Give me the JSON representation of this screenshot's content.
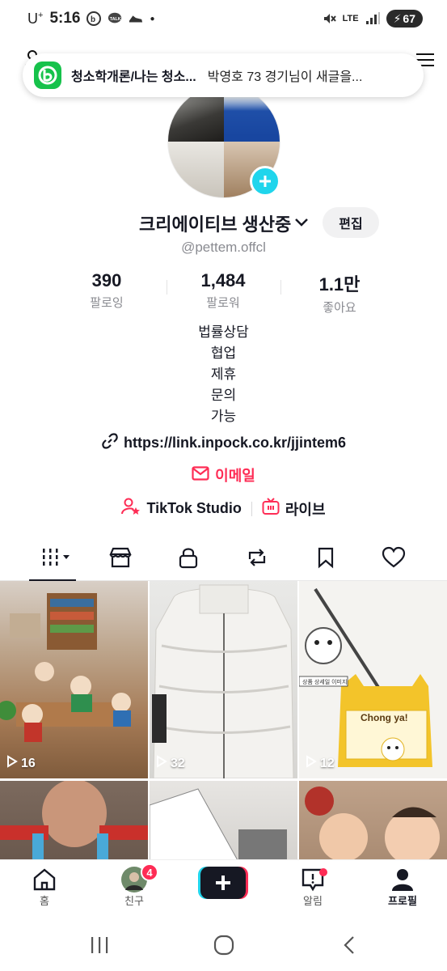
{
  "statusbar": {
    "carrier": "U",
    "carrier_sup": "+",
    "time": "5:16",
    "talk_label": "TALK",
    "network": "LTE",
    "battery": "67"
  },
  "notification": {
    "app_icon": "band-app-icon",
    "title": "청소학개론/나는 청소...",
    "body": "박영호  73 경기님이 새글을..."
  },
  "profile": {
    "display_name": "크리에이티브 생산중",
    "handle": "@pettem.offcl",
    "edit_label": "편집",
    "stats": [
      {
        "value": "390",
        "label": "팔로잉"
      },
      {
        "value": "1,484",
        "label": "팔로워"
      },
      {
        "value": "1.1만",
        "label": "좋아요"
      }
    ],
    "bio_lines": [
      "법률상담",
      "협업",
      "제휴",
      "문의",
      "가능"
    ],
    "link": "https://link.inpock.co.kr/jjintem6",
    "email_label": "이메일",
    "tools": [
      {
        "label": "TikTok Studio",
        "icon": "studio-icon"
      },
      {
        "label": "라이브",
        "icon": "live-tv-icon"
      }
    ]
  },
  "tabs": [
    {
      "icon": "videos-grid-icon",
      "active": true
    },
    {
      "icon": "shop-icon"
    },
    {
      "icon": "lock-icon"
    },
    {
      "icon": "repost-icon"
    },
    {
      "icon": "bookmark-icon"
    },
    {
      "icon": "heart-icon"
    }
  ],
  "videos": [
    {
      "views": "16",
      "theme": "classroom illustration"
    },
    {
      "views": "32",
      "theme": "white puffer jacket"
    },
    {
      "views": "12",
      "theme": "Chong ya! bag",
      "bag_text": "Chong ya!",
      "sticker_text": "상품 상세일 이미지"
    },
    {
      "theme": "man with handlebars"
    },
    {
      "theme": "tablet drawing"
    },
    {
      "theme": "kids smiling"
    }
  ],
  "bottomnav": [
    {
      "label": "홈",
      "icon": "home-icon"
    },
    {
      "label": "친구",
      "icon": "friends-avatar-icon",
      "badge": "4"
    },
    {
      "label": "",
      "icon": "create-plus-icon"
    },
    {
      "label": "알림",
      "icon": "inbox-icon",
      "dot": true
    },
    {
      "label": "프로필",
      "icon": "profile-icon",
      "active": true
    }
  ],
  "colors": {
    "accent": "#fe2c55",
    "cyan": "#20d5ec",
    "muted_text": "#8a8b91",
    "band_green": "#16c24b"
  }
}
